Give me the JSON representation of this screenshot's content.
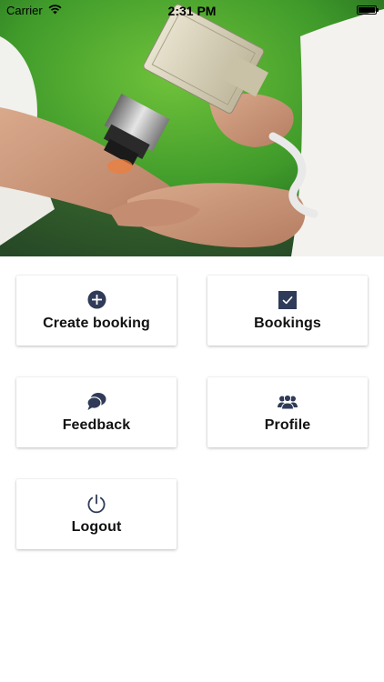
{
  "status_bar": {
    "carrier": "Carrier",
    "time": "2:31 PM",
    "battery_level": 1.0
  },
  "hero": {
    "description_icon": "laser-treatment-photo"
  },
  "colors": {
    "icon": "#2f3b58",
    "label": "#111111",
    "background": "#ffffff"
  },
  "menu": {
    "create_booking": {
      "label": "Create booking",
      "icon": "plus-circle-icon"
    },
    "bookings": {
      "label": "Bookings",
      "icon": "check-square-icon"
    },
    "feedback": {
      "label": "Feedback",
      "icon": "chat-bubbles-icon"
    },
    "profile": {
      "label": "Profile",
      "icon": "users-group-icon"
    },
    "logout": {
      "label": "Logout",
      "icon": "power-icon"
    }
  }
}
